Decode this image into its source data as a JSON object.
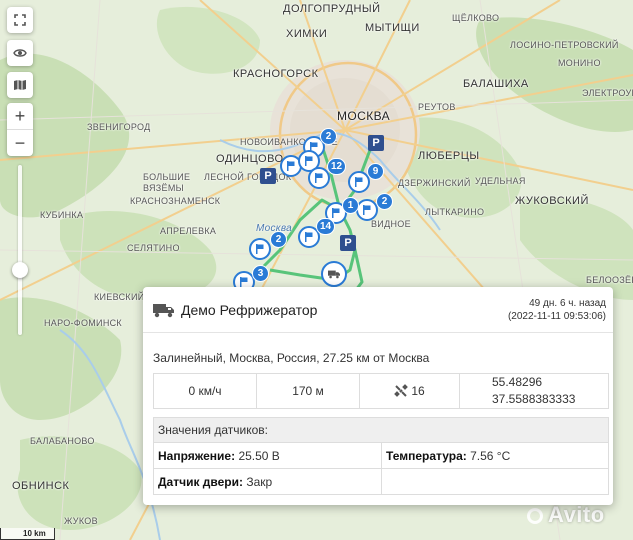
{
  "places": [
    {
      "id": "dolgoprudny",
      "label": "ДОЛГОПРУДНЫЙ",
      "cls": "big"
    },
    {
      "id": "khimki",
      "label": "ХИМКИ",
      "cls": "big"
    },
    {
      "id": "mytishchi",
      "label": "МЫТИЩИ",
      "cls": "big"
    },
    {
      "id": "shchelkovo",
      "label": "ЩЁЛКОВО",
      "cls": ""
    },
    {
      "id": "krasnogorsk",
      "label": "КРАСНОГОРСК",
      "cls": "big"
    },
    {
      "id": "balashikha",
      "label": "БАЛАШИХА",
      "cls": "big"
    },
    {
      "id": "moskva",
      "label": "МОСКВА",
      "cls": "city"
    },
    {
      "id": "reutov",
      "label": "РЕУТОВ",
      "cls": ""
    },
    {
      "id": "zvenigorod",
      "label": "ЗВЕНИГОРОД",
      "cls": ""
    },
    {
      "id": "odintsovo",
      "label": "ОДИНЦОВО",
      "cls": "big"
    },
    {
      "id": "lyubertsy",
      "label": "ЛЮБЕРЦЫ",
      "cls": "big"
    },
    {
      "id": "novoivankovskoe",
      "label": "НОВОИВАНКОВСКОЕ",
      "cls": ""
    },
    {
      "id": "lesnoy",
      "label": "ЛЕСНОЙ ГОРОДОК",
      "cls": ""
    },
    {
      "id": "bolshie",
      "label": "БОЛЬШИЕ",
      "cls": ""
    },
    {
      "id": "vyazemy",
      "label": "ВЯЗЁМЫ",
      "cls": ""
    },
    {
      "id": "krasnoznamensk",
      "label": "КРАСНОЗНАМЕНСК",
      "cls": ""
    },
    {
      "id": "kubinka",
      "label": "КУБИНКА",
      "cls": ""
    },
    {
      "id": "aprelevka",
      "label": "АПРЕЛЕВКА",
      "cls": ""
    },
    {
      "id": "selyatino",
      "label": "СЕЛЯТИНО",
      "cls": ""
    },
    {
      "id": "dzerzhinsky",
      "label": "ДЗЕРЖИНСКИЙ",
      "cls": ""
    },
    {
      "id": "lytkarino",
      "label": "ЛЫТКАРИНО",
      "cls": ""
    },
    {
      "id": "zhukovsky",
      "label": "ЖУКОВСКИЙ",
      "cls": "big"
    },
    {
      "id": "udelnaya",
      "label": "УДЕЛЬНАЯ",
      "cls": ""
    },
    {
      "id": "vidnoe",
      "label": "ВИДНОЕ",
      "cls": ""
    },
    {
      "id": "kievsky",
      "label": "КИЕВСКИЙ",
      "cls": ""
    },
    {
      "id": "naro",
      "label": "НАРО-ФОМИНСК",
      "cls": ""
    },
    {
      "id": "balabanovo",
      "label": "БАЛАБАНОВО",
      "cls": ""
    },
    {
      "id": "obninsk",
      "label": "ОБНИНСК",
      "cls": "big"
    },
    {
      "id": "zhukov",
      "label": "ЖУКОВ",
      "cls": ""
    },
    {
      "id": "losino",
      "label": "ЛОСИНО-ПЕТРОВСКИЙ",
      "cls": ""
    },
    {
      "id": "monino",
      "label": "МОНИНО",
      "cls": ""
    },
    {
      "id": "elektrostal",
      "label": "ЭЛЕКТРОУГЛИ",
      "cls": ""
    },
    {
      "id": "belouserovo",
      "label": "БЕЛООЗЁРСКИЙ",
      "cls": ""
    },
    {
      "id": "moskva-river",
      "label": "Москва",
      "cls": ""
    }
  ],
  "clusters": [
    {
      "id": "c1",
      "count": "2"
    },
    {
      "id": "c2",
      "count": "12"
    },
    {
      "id": "c3",
      "count": "9"
    },
    {
      "id": "c4",
      "count": "2"
    },
    {
      "id": "c5",
      "count": "1"
    },
    {
      "id": "c6",
      "count": "14"
    },
    {
      "id": "c7",
      "count": "2"
    },
    {
      "id": "c8",
      "count": "3"
    }
  ],
  "popup": {
    "vehicle_name": "Демо Рефрижератор",
    "time_ago": "49 дн. 6 ч. назад",
    "timestamp": "(2022-11-11 09:53:06)",
    "address": "Залинейный, Москва, Россия, 27.25 км от Москва",
    "speed": "0 км/ч",
    "altitude": "170 м",
    "satellites": "16",
    "latitude": "55.48296",
    "longitude": "37.5588383333",
    "sensors_title": "Значения датчиков:",
    "voltage_label": "Напряжение:",
    "voltage_value": "25.50 В",
    "temperature_label": "Температура:",
    "temperature_value": "7.56 °C",
    "door_label": "Датчик двери:",
    "door_value": "Закр"
  },
  "scale_label": "10 km",
  "watermark": "Avito",
  "colors": {
    "route": "#58c47a",
    "marker": "#2a7bd6",
    "parking": "#2f4f8f"
  }
}
